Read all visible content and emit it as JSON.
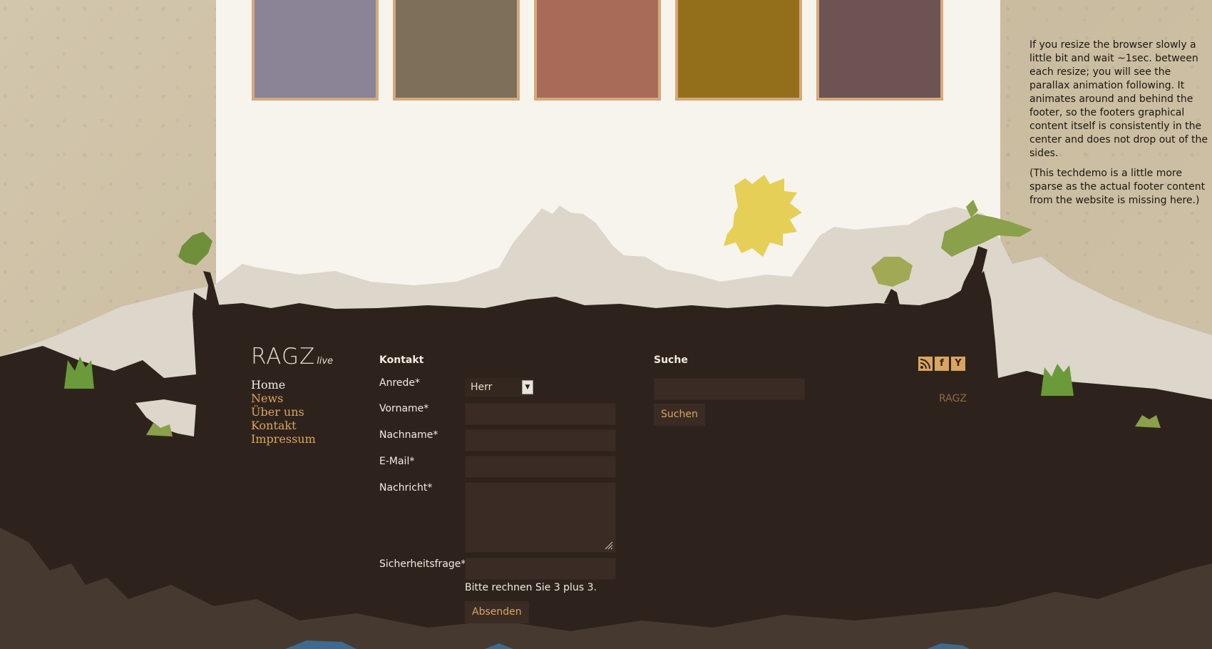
{
  "colors": {
    "swatches": [
      "#8a8496",
      "#7e6f5b",
      "#a86b58",
      "#946f1b",
      "#6d5352"
    ],
    "swatch_border": "#d6a87a",
    "footer_bg": "#2e231c",
    "accent": "#d9a560"
  },
  "side_note": {
    "paragraph1": "If you resize the browser slowly a little bit and wait ~1sec. between each resize; you will see the parallax animation following. It animates around and behind the footer, so the footers graphical content itself is consistently in the center and does not drop out of the sides.",
    "paragraph2": "(This techdemo is a little more sparse as the actual footer content from the website is missing here.)"
  },
  "logo": {
    "main": "RAGZ",
    "sub": "live"
  },
  "nav": {
    "items": [
      {
        "label": "Home"
      },
      {
        "label": "News"
      },
      {
        "label": "Über uns"
      },
      {
        "label": "Kontakt"
      },
      {
        "label": "Impressum"
      }
    ]
  },
  "contact": {
    "heading": "Kontakt",
    "salutation_label": "Anrede*",
    "salutation_value": "Herr",
    "firstname_label": "Vorname*",
    "lastname_label": "Nachname*",
    "email_label": "E-Mail*",
    "message_label": "Nachricht*",
    "security_label": "Sicherheitsfrage*",
    "security_question": "Bitte rechnen Sie 3 plus 3.",
    "submit_label": "Absenden"
  },
  "search": {
    "heading": "Suche",
    "button_label": "Suchen"
  },
  "social": {
    "icons": [
      "rss-icon",
      "facebook-icon",
      "yahoo-icon"
    ],
    "facebook_glyph": "f",
    "yahoo_glyph": "Y"
  },
  "footer_link": "RAGZ"
}
